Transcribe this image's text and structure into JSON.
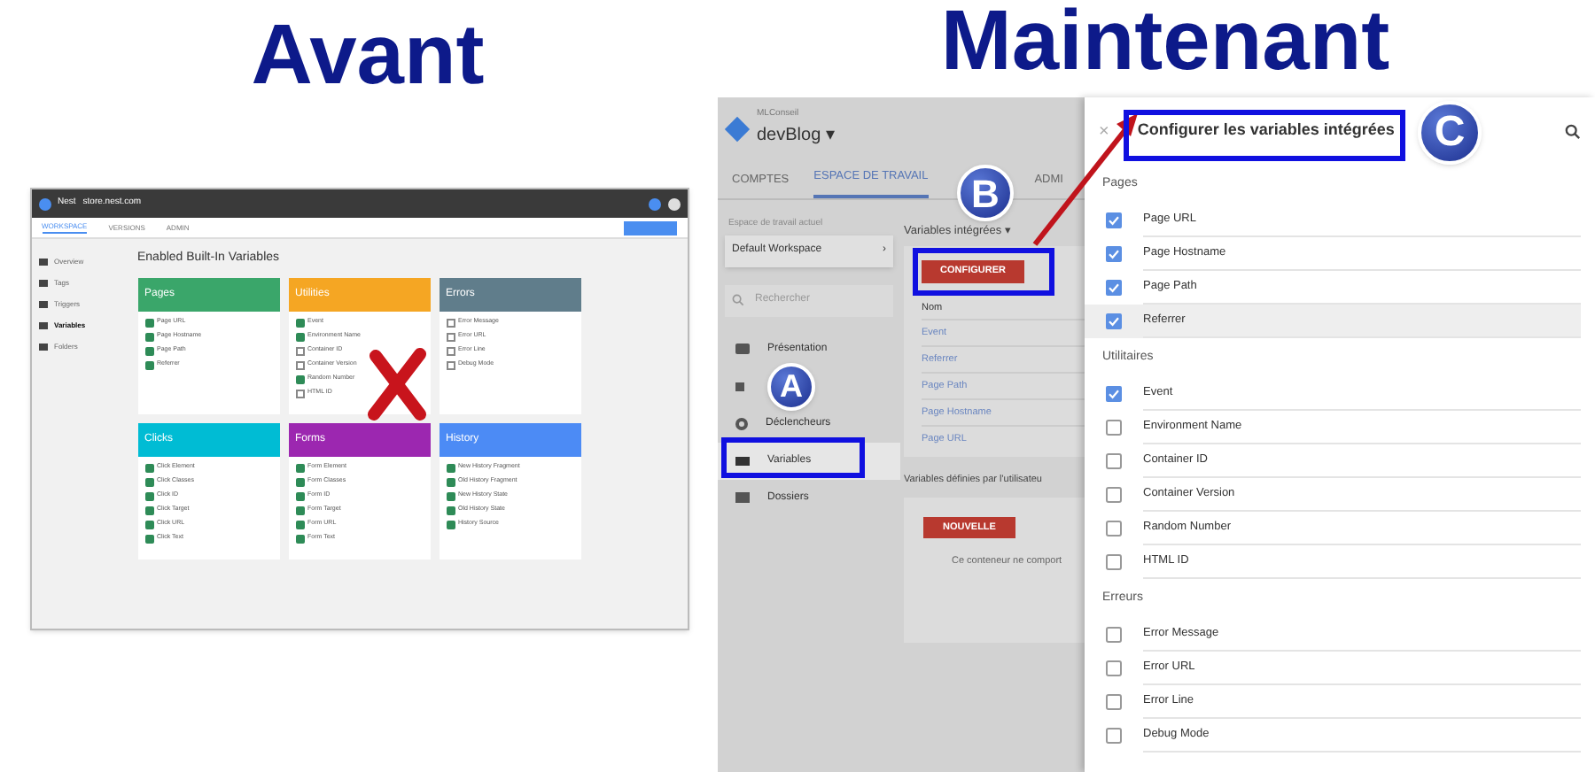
{
  "headings": {
    "before": "Avant",
    "after": "Maintenant"
  },
  "before_screen": {
    "breadcrumb": [
      "Nest",
      "store.nest.com"
    ],
    "tabs": [
      {
        "label": "WORKSPACE",
        "selected": true
      },
      {
        "label": "VERSIONS",
        "selected": false
      },
      {
        "label": "ADMIN",
        "selected": false
      }
    ],
    "sidebar": [
      {
        "label": "Overview",
        "selected": false
      },
      {
        "label": "Tags",
        "selected": false
      },
      {
        "label": "Triggers",
        "selected": false
      },
      {
        "label": "Variables",
        "selected": true
      },
      {
        "label": "Folders",
        "selected": false
      }
    ],
    "title": "Enabled Built-In Variables",
    "cards": [
      {
        "title": "Pages",
        "color": "#3aa66a",
        "items": [
          {
            "label": "Page URL",
            "checked": true
          },
          {
            "label": "Page Hostname",
            "checked": true
          },
          {
            "label": "Page Path",
            "checked": true
          },
          {
            "label": "Referrer",
            "checked": true
          }
        ]
      },
      {
        "title": "Utilities",
        "color": "#f5a623",
        "items": [
          {
            "label": "Event",
            "checked": true
          },
          {
            "label": "Environment Name",
            "checked": true
          },
          {
            "label": "Container ID",
            "checked": false
          },
          {
            "label": "Container Version",
            "checked": false
          },
          {
            "label": "Random Number",
            "checked": true
          },
          {
            "label": "HTML ID",
            "checked": false
          }
        ]
      },
      {
        "title": "Errors",
        "color": "#607d8b",
        "items": [
          {
            "label": "Error Message",
            "checked": false
          },
          {
            "label": "Error URL",
            "checked": false
          },
          {
            "label": "Error Line",
            "checked": false
          },
          {
            "label": "Debug Mode",
            "checked": false
          }
        ]
      },
      {
        "title": "Clicks",
        "color": "#00bcd4",
        "items": [
          {
            "label": "Click Element",
            "checked": true
          },
          {
            "label": "Click Classes",
            "checked": true
          },
          {
            "label": "Click ID",
            "checked": true
          },
          {
            "label": "Click Target",
            "checked": true
          },
          {
            "label": "Click URL",
            "checked": true
          },
          {
            "label": "Click Text",
            "checked": true
          }
        ]
      },
      {
        "title": "Forms",
        "color": "#9c27b0",
        "items": [
          {
            "label": "Form Element",
            "checked": true
          },
          {
            "label": "Form Classes",
            "checked": true
          },
          {
            "label": "Form ID",
            "checked": true
          },
          {
            "label": "Form Target",
            "checked": true
          },
          {
            "label": "Form URL",
            "checked": true
          },
          {
            "label": "Form Text",
            "checked": true
          }
        ]
      },
      {
        "title": "History",
        "color": "#4c8bf5",
        "items": [
          {
            "label": "New History Fragment",
            "checked": true
          },
          {
            "label": "Old History Fragment",
            "checked": true
          },
          {
            "label": "New History State",
            "checked": true
          },
          {
            "label": "Old History State",
            "checked": true
          },
          {
            "label": "History Source",
            "checked": true
          }
        ]
      }
    ]
  },
  "after_screen": {
    "account": "MLConseil",
    "container": "devBlog",
    "container_caret": "▾",
    "workspace_arrow": "›",
    "title_caret": "▾",
    "tabs": [
      {
        "label": "COMPTES",
        "selected": false
      },
      {
        "label": "ESPACE DE TRAVAIL",
        "selected": true
      },
      {
        "label": "ADMI",
        "selected": false
      }
    ],
    "workspace_label": "Espace de travail actuel",
    "workspace": "Default Workspace",
    "search": {
      "placeholder": "Rechercher"
    },
    "nav": [
      {
        "kind": "overview",
        "label": "Présentation",
        "selected": false
      },
      {
        "kind": "tags",
        "selected": false
      },
      {
        "kind": "triggers",
        "label": "Déclencheurs",
        "selected": false
      },
      {
        "kind": "variables",
        "label": "Variables",
        "selected": true
      },
      {
        "kind": "folders",
        "label": "Dossiers",
        "selected": false
      }
    ],
    "builtin_title": "Variables intégrées",
    "configure_button": "CONFIGURER",
    "column": "Nom",
    "rows": [
      "Event",
      "Referrer",
      "Page Path",
      "Page Hostname",
      "Page URL"
    ],
    "user_title": "Variables définies par l'utilisateu",
    "new_button": "NOUVELLE",
    "empty_text": "Ce conteneur ne comport"
  },
  "drawer": {
    "close": "×",
    "title": "Configurer les variables intégrées",
    "sections": [
      {
        "title": "Pages",
        "items": [
          {
            "label": "Page URL",
            "checked": true,
            "hovered": false
          },
          {
            "label": "Page Hostname",
            "checked": true,
            "hovered": false
          },
          {
            "label": "Page Path",
            "checked": true,
            "hovered": false
          },
          {
            "label": "Referrer",
            "checked": true,
            "hovered": true
          }
        ]
      },
      {
        "title": "Utilitaires",
        "items": [
          {
            "label": "Event",
            "checked": true,
            "hovered": false
          },
          {
            "label": "Environment Name",
            "checked": false,
            "hovered": false
          },
          {
            "label": "Container ID",
            "checked": false,
            "hovered": false
          },
          {
            "label": "Container Version",
            "checked": false,
            "hovered": false
          },
          {
            "label": "Random Number",
            "checked": false,
            "hovered": false
          },
          {
            "label": "HTML ID",
            "checked": false,
            "hovered": false
          }
        ]
      },
      {
        "title": "Erreurs",
        "items": [
          {
            "label": "Error Message",
            "checked": false,
            "hovered": false
          },
          {
            "label": "Error URL",
            "checked": false,
            "hovered": false
          },
          {
            "label": "Error Line",
            "checked": false,
            "hovered": false
          },
          {
            "label": "Debug Mode",
            "checked": false,
            "hovered": false
          }
        ]
      }
    ]
  },
  "annotations": [
    {
      "letter": "A"
    },
    {
      "letter": "B"
    },
    {
      "letter": "C"
    }
  ]
}
